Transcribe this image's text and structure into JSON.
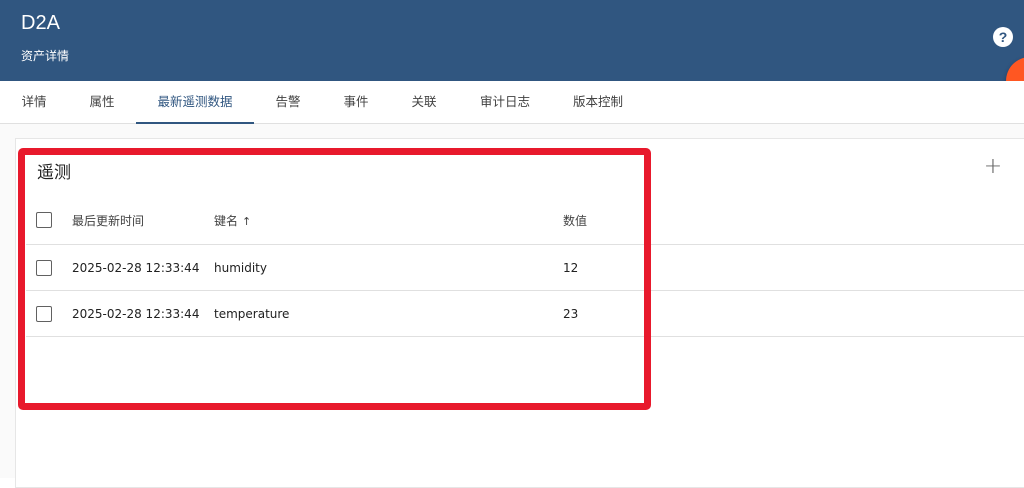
{
  "header": {
    "title": "D2A",
    "subtitle": "资产详情",
    "help_icon": "help-circle-icon",
    "help_glyph": "?"
  },
  "tabs": [
    {
      "label": "详情"
    },
    {
      "label": "属性"
    },
    {
      "label": "最新遥测数据",
      "active": true
    },
    {
      "label": "告警"
    },
    {
      "label": "事件"
    },
    {
      "label": "关联"
    },
    {
      "label": "审计日志"
    },
    {
      "label": "版本控制"
    }
  ],
  "telemetry": {
    "title": "遥测",
    "add_icon": "plus-icon",
    "add_glyph": "+",
    "columns": {
      "last_update": "最后更新时间",
      "key": "键名",
      "key_sort_glyph": "↑",
      "value": "数值"
    },
    "rows": [
      {
        "last_update": "2025-02-28 12:33:44",
        "key": "humidity",
        "value": "12"
      },
      {
        "last_update": "2025-02-28 12:33:44",
        "key": "temperature",
        "value": "23"
      }
    ]
  },
  "colors": {
    "header_bg": "#305680",
    "accent": "#305680",
    "fab": "#ff5722",
    "highlight": "#e8192c"
  }
}
